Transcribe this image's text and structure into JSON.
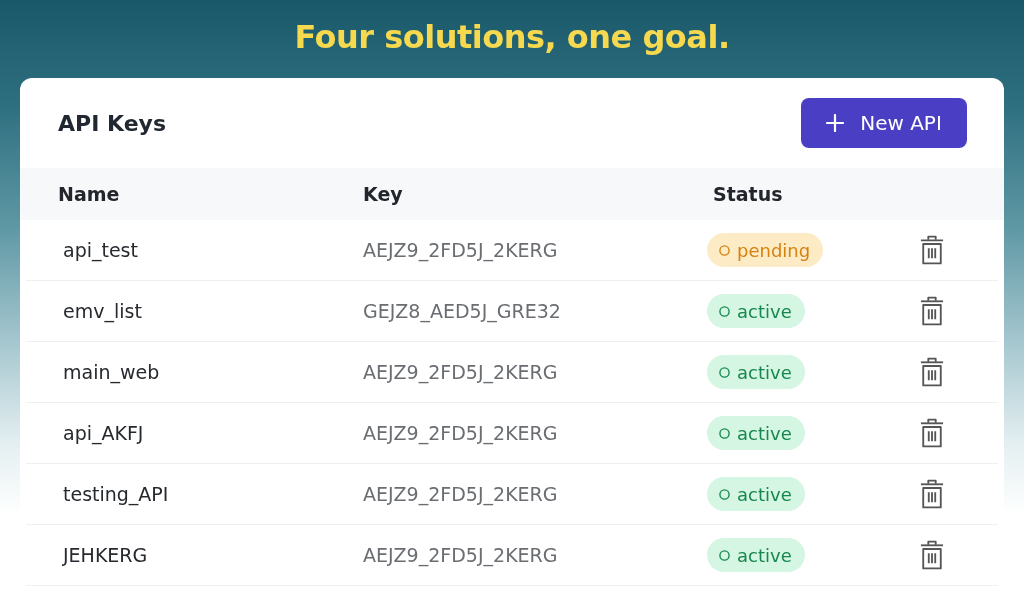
{
  "page": {
    "heading": "Four solutions, one goal."
  },
  "card": {
    "title": "API Keys",
    "new_button": {
      "label": "New API"
    }
  },
  "table": {
    "columns": [
      "Name",
      "Key",
      "Status"
    ],
    "rows": [
      {
        "name": "api_test",
        "key": "AEJZ9_2FD5J_2KERG",
        "status": {
          "label": "pending",
          "kind": "pending"
        }
      },
      {
        "name": "emv_list",
        "key": "GEJZ8_AED5J_GRE32",
        "status": {
          "label": "active",
          "kind": "active"
        }
      },
      {
        "name": "main_web",
        "key": "AEJZ9_2FD5J_2KERG",
        "status": {
          "label": "active",
          "kind": "active"
        }
      },
      {
        "name": "api_AKFJ",
        "key": "AEJZ9_2FD5J_2KERG",
        "status": {
          "label": "active",
          "kind": "active"
        }
      },
      {
        "name": "testing_API",
        "key": "AEJZ9_2FD5J_2KERG",
        "status": {
          "label": "active",
          "kind": "active"
        }
      },
      {
        "name": "JEHKERG",
        "key": "AEJZ9_2FD5J_2KERG",
        "status": {
          "label": "active",
          "kind": "active"
        }
      }
    ]
  }
}
